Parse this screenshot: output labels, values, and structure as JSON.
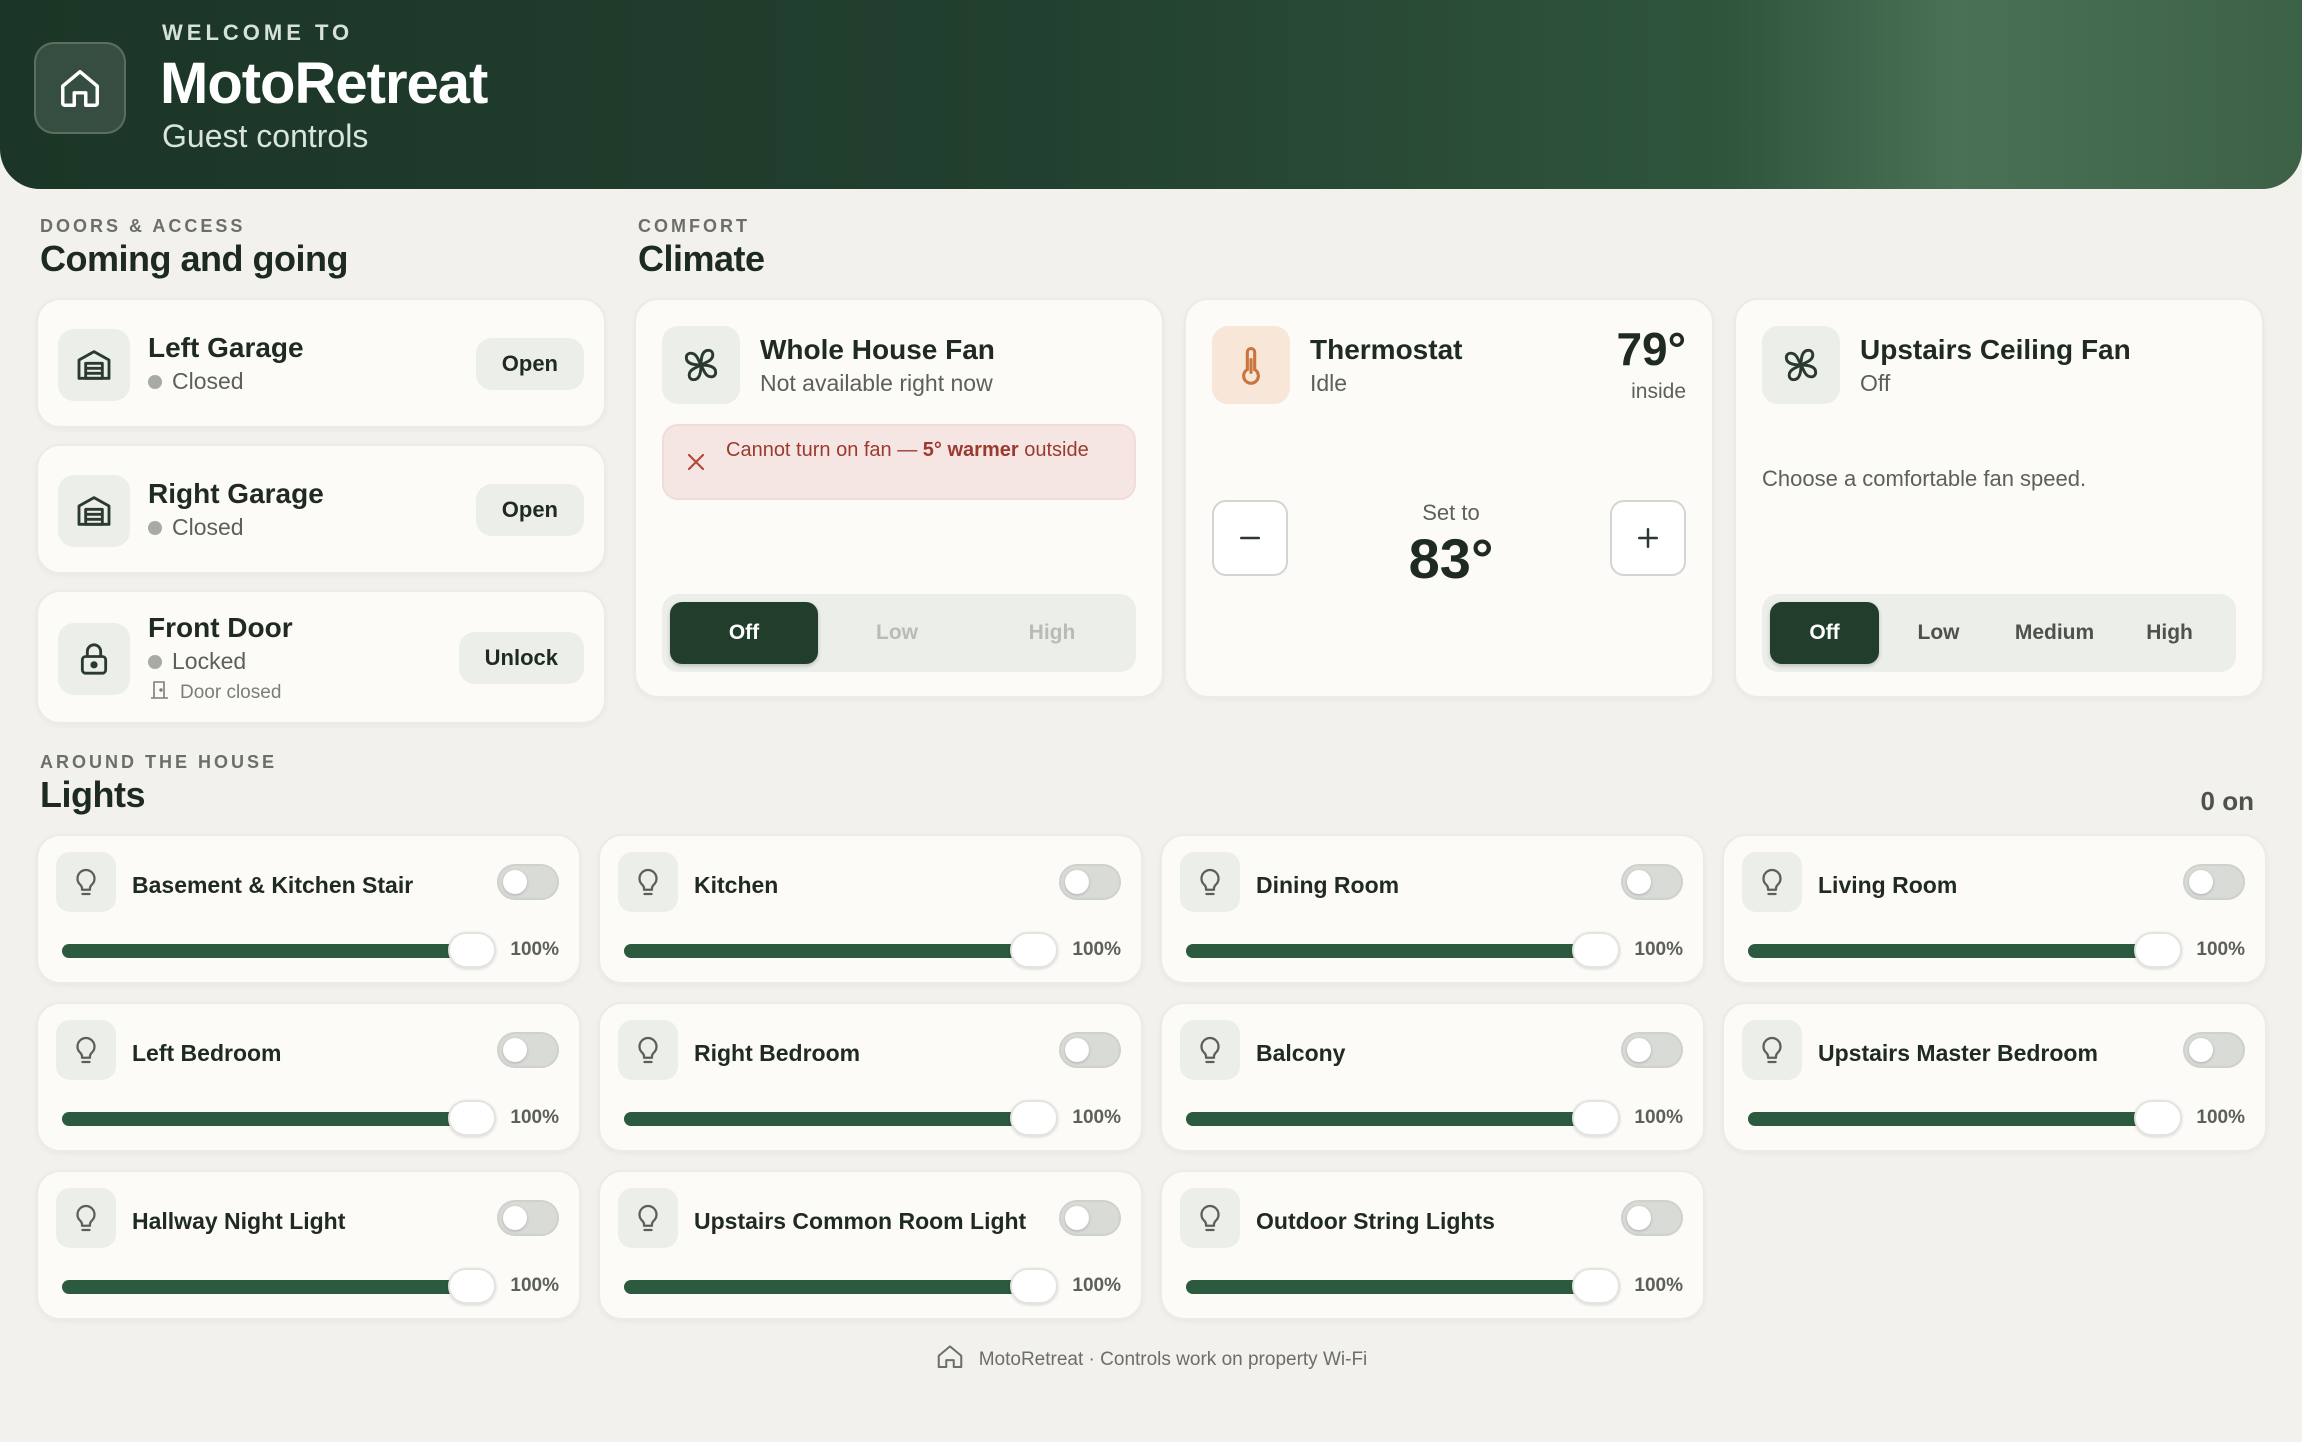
{
  "header": {
    "welcome": "WELCOME TO",
    "brand": "MotoRetreat",
    "subtitle": "Guest controls"
  },
  "doors": {
    "kicker": "DOORS & ACCESS",
    "title": "Coming and going",
    "items": [
      {
        "name": "Left Garage",
        "status": "Closed",
        "action": "Open"
      },
      {
        "name": "Right Garage",
        "status": "Closed",
        "action": "Open"
      },
      {
        "name": "Front Door",
        "status": "Locked",
        "sub": "Door closed",
        "action": "Unlock"
      }
    ]
  },
  "climate": {
    "kicker": "COMFORT",
    "title": "Climate",
    "whole_house_fan": {
      "title": "Whole House Fan",
      "sub": "Not available right now",
      "alert_prefix": "Cannot turn on fan — ",
      "alert_bold": "5° warmer",
      "alert_suffix": " outside",
      "options": [
        "Off",
        "Low",
        "High"
      ],
      "selected": "Off"
    },
    "thermostat": {
      "title": "Thermostat",
      "sub": "Idle",
      "current": "79°",
      "current_label": "inside",
      "set_label": "Set to",
      "set_value": "83°"
    },
    "ceiling_fan": {
      "title": "Upstairs Ceiling Fan",
      "sub": "Off",
      "hint": "Choose a comfortable fan speed.",
      "options": [
        "Off",
        "Low",
        "Medium",
        "High"
      ],
      "selected": "Off"
    }
  },
  "lights": {
    "kicker": "AROUND THE HOUSE",
    "title": "Lights",
    "count": "0 on",
    "items": [
      {
        "name": "Basement & Kitchen Stair",
        "level": "100%",
        "on": false
      },
      {
        "name": "Kitchen",
        "level": "100%",
        "on": false
      },
      {
        "name": "Dining Room",
        "level": "100%",
        "on": false
      },
      {
        "name": "Living Room",
        "level": "100%",
        "on": false
      },
      {
        "name": "Left Bedroom",
        "level": "100%",
        "on": false
      },
      {
        "name": "Right Bedroom",
        "level": "100%",
        "on": false
      },
      {
        "name": "Balcony",
        "level": "100%",
        "on": false
      },
      {
        "name": "Upstairs Master Bedroom",
        "level": "100%",
        "on": false
      },
      {
        "name": "Hallway Night Light",
        "level": "100%",
        "on": false
      },
      {
        "name": "Upstairs Common Room Light",
        "level": "100%",
        "on": false
      },
      {
        "name": "Outdoor String Lights",
        "level": "100%",
        "on": false
      }
    ]
  },
  "footer": {
    "text": "MotoRetreat · Controls work on property Wi-Fi"
  },
  "colors": {
    "header_dark": "#1b3526",
    "accent": "#213d2b",
    "slider_fill": "#2c5a3e",
    "alert_bg": "#f6e6e3",
    "alert_text": "#9b3a2e",
    "background": "#f3f1ec"
  },
  "icons": {
    "home": "home-icon",
    "garage": "garage-icon",
    "lock": "lock-icon",
    "door": "door-icon",
    "fan": "fan-icon",
    "thermometer": "thermometer-icon",
    "bulb": "lightbulb-icon",
    "close": "close-icon",
    "minus": "minus-icon",
    "plus": "plus-icon"
  }
}
